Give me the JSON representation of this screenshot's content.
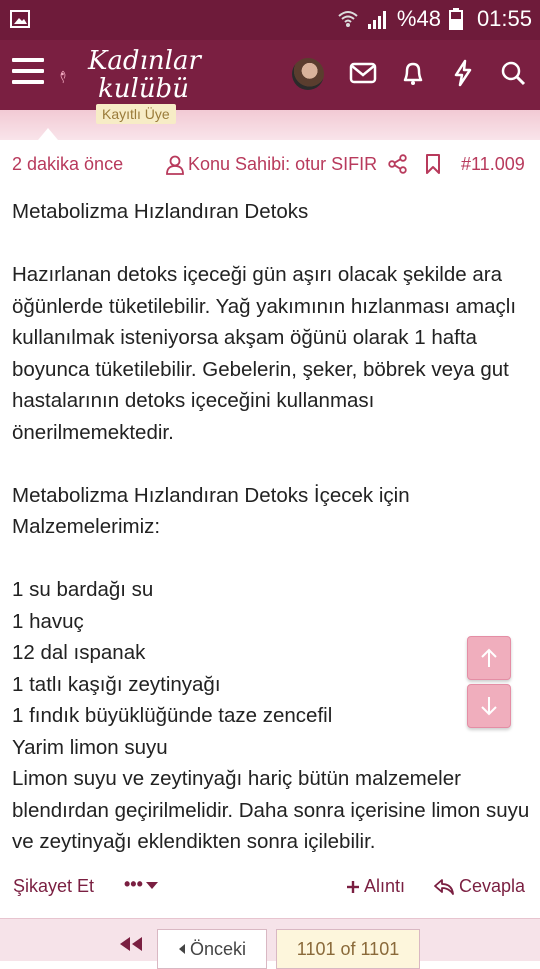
{
  "status_bar": {
    "battery": "%48",
    "time": "01:55",
    "icons": [
      "image-icon",
      "wifi-icon",
      "signal-icon",
      "battery-icon"
    ]
  },
  "header": {
    "logo_line1": "Kadınlar",
    "logo_line2": "kulübü",
    "icons": [
      "menu-icon",
      "avatar",
      "messages-icon",
      "bell-icon",
      "bolt-icon",
      "search-icon"
    ]
  },
  "user_badge": "Kayıtlı Üye",
  "post_meta": {
    "time": "2 dakika önce",
    "owner": "Konu Sahibi: otur SIFIR",
    "post_number": "#11.009"
  },
  "post": {
    "title": "Metabolizma Hızlandıran Detoks",
    "para1": "Hazırlanan detoks içeceği gün aşırı olacak şekilde ara öğünlerde tüketilebilir. Yağ yakımının hızlanması amaçlı kullanılmak isteniyorsa akşam öğünü olarak 1 hafta boyunca tüketilebilir. Gebelerin, şeker, böbrek veya gut hastalarının detoks içeceğini kullanması önerilmemektedir.",
    "heading2": "Metabolizma Hızlandıran Detoks İçecek için Malzemelerimiz:",
    "ingredients": [
      "1 su bardağı su",
      "1 havuç",
      "12 dal ıspanak",
      "1 tatlı kaşığı zeytinyağı",
      "1 fındık büyüklüğünde taze zencefil",
      "Yarim limon suyu"
    ],
    "para2": "Limon suyu ve zeytinyağı hariç bütün malzemeler blendırdan geçirilmelidir. Daha sonra içerisine limon suyu ve zeytinyağı eklendikten sonra içilebilir."
  },
  "actions": {
    "report": "Şikayet Et",
    "more": "•••",
    "quote": "Alıntı",
    "reply": "Cevapla"
  },
  "pagination": {
    "prev": "Önceki",
    "current": "1101 of 1101"
  },
  "colors": {
    "brand": "#7a1f41",
    "accent": "#b83a5c",
    "fab": "#f0aebd"
  }
}
